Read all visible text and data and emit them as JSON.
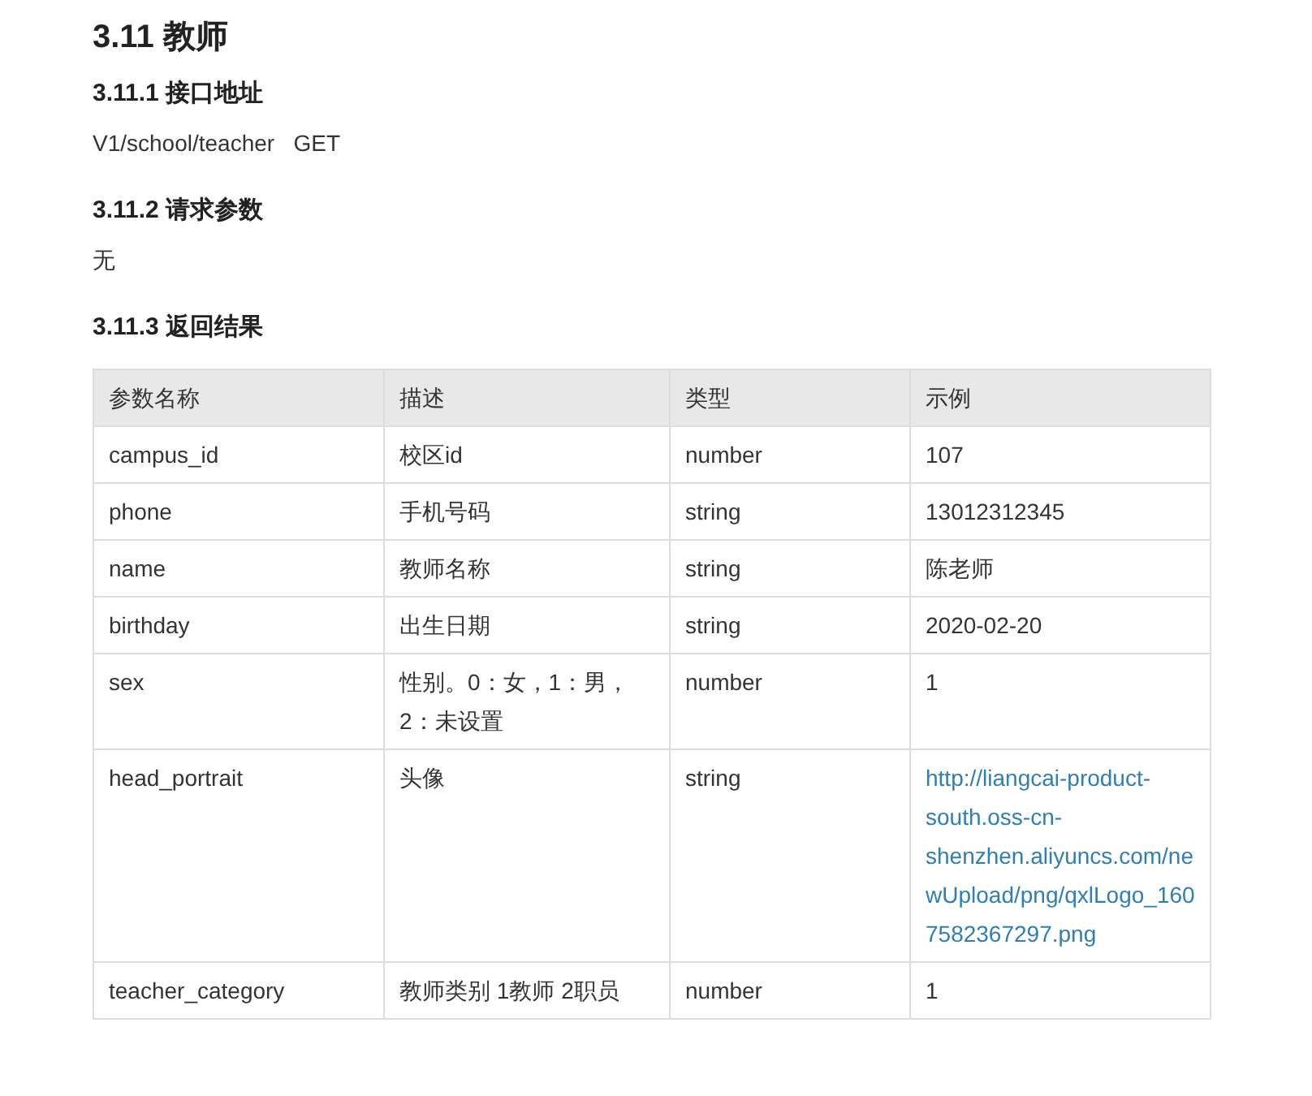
{
  "title": "3.11 教师",
  "sections": [
    {
      "heading": "3.11.1 接口地址",
      "text": "V1/school/teacher   GET"
    },
    {
      "heading": "3.11.2 请求参数",
      "text": "无"
    },
    {
      "heading": "3.11.3 返回结果"
    }
  ],
  "table": {
    "columns": [
      "参数名称",
      "描述",
      "类型",
      "示例"
    ],
    "rows": [
      [
        "campus_id",
        "校区id",
        "number",
        "107"
      ],
      [
        "phone",
        "手机号码",
        "string",
        "13012312345"
      ],
      [
        "name",
        "教师名称",
        "string",
        "陈老师"
      ],
      [
        "birthday",
        "出生日期",
        "string",
        "2020-02-20"
      ],
      [
        "sex",
        "性别。0：女，1：男，2：未设置",
        "number",
        "1"
      ],
      [
        "head_portrait",
        "头像",
        "string",
        {
          "kind": "link",
          "text": "http://liangcai-product-south.oss-cn-shenzhen.aliyuncs.com/newUpload/png/qxlLogo_1607582367297.png"
        }
      ],
      [
        "teacher_category",
        "教师类别 1教师 2职员",
        "number",
        "1"
      ]
    ]
  }
}
